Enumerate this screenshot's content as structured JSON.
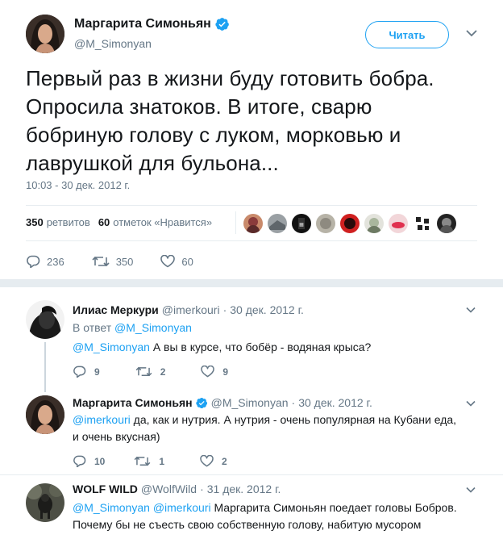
{
  "main_tweet": {
    "name": "Маргарита Симоньян",
    "handle": "@M_Simonyan",
    "follow_label": "Читать",
    "text_lines": [
      "Первый раз в жизни буду готовить бобра.",
      "Опросила знатоков. В итоге, сварю",
      "бобриную голову с луком, морковью и",
      "лаврушкой для бульона..."
    ],
    "timestamp": "10:03 - 30 дек. 2012 г.",
    "retweets_count": "350",
    "retweets_label": "ретвитов",
    "likes_count": "60",
    "likes_label": "отметок «Нравится»",
    "reply_count": "236",
    "retweet_count": "350",
    "like_count": "60",
    "verified": true,
    "accent_color": "#1da1f2"
  },
  "replies": [
    {
      "name": "Илиас Меркури",
      "handle": "@imerkouri",
      "date": "30 дек. 2012 г.",
      "in_reply_prefix": "В ответ",
      "in_reply_handle": "@M_Simonyan",
      "mention": "@M_Simonyan",
      "text": "А вы в курсе, что бобёр - водяная крыса?",
      "reply_count": "9",
      "retweet_count": "2",
      "like_count": "9"
    },
    {
      "name": "Маргарита Симоньян",
      "handle": "@M_Simonyan",
      "date": "30 дек. 2012 г.",
      "verified": true,
      "mention": "@imerkouri",
      "text": "да, как и нутрия. А нутрия - очень популярная на Кубани еда, и очень вкусная)",
      "reply_count": "10",
      "retweet_count": "1",
      "like_count": "2"
    },
    {
      "name": "WOLF WILD",
      "handle": "@WolfWild",
      "date": "31 дек. 2012 г.",
      "mention1": "@M_Simonyan",
      "mention2": "@imerkouri",
      "text": "Маргарита Симоньян поедает головы Бобров. Почему бы не съесть свою собственную голову, набитую мусором"
    }
  ],
  "separator_dot": "·",
  "icons": [
    "verified-icon",
    "chevron-down-icon",
    "reply-icon",
    "retweet-icon",
    "like-icon"
  ]
}
